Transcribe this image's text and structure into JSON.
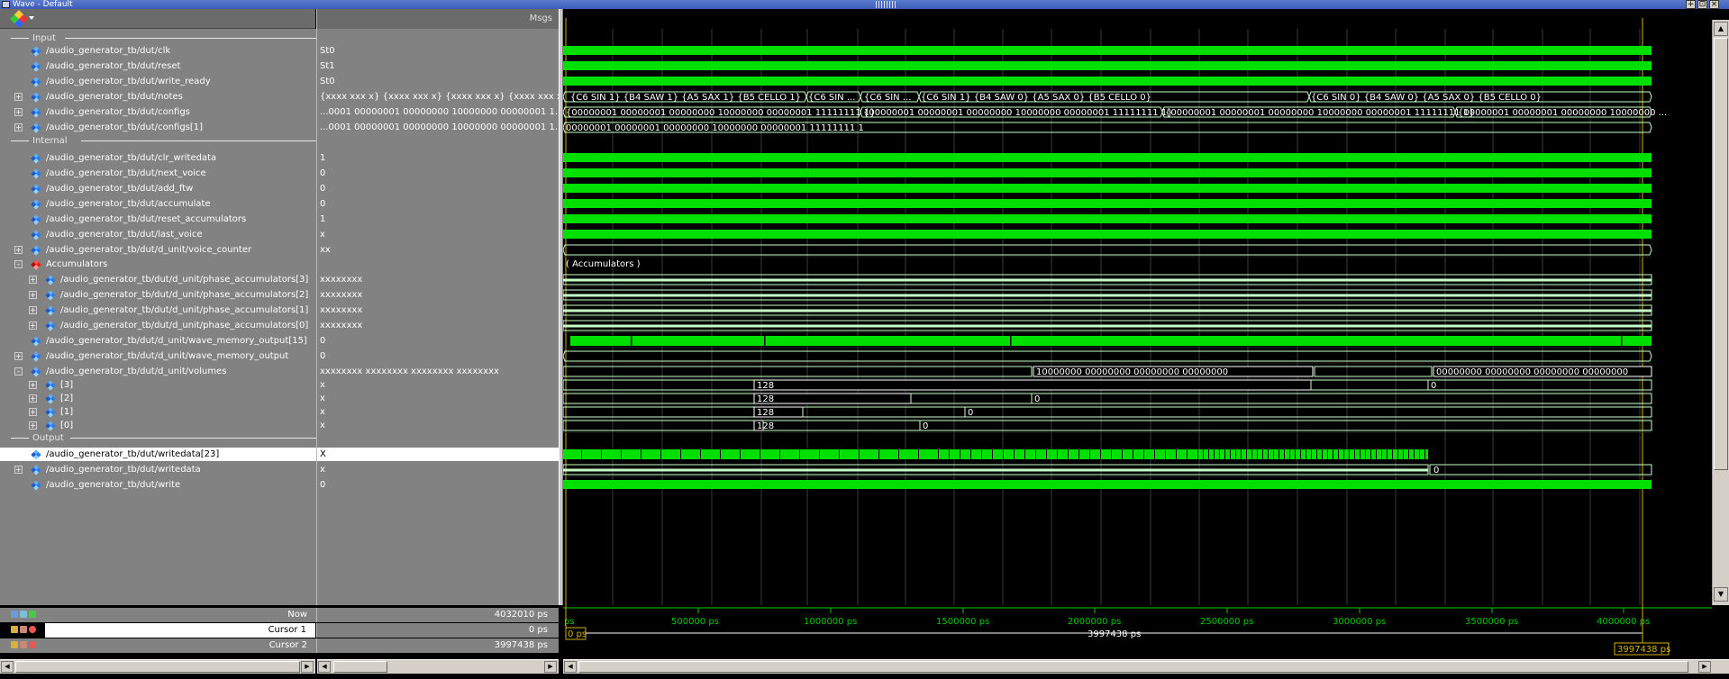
{
  "window": {
    "title": "Wave - Default",
    "buttons": [
      "+",
      "⊡",
      "×"
    ]
  },
  "header": {
    "msgs_label": "Msgs"
  },
  "rows": [
    {
      "kind": "group",
      "label": "Input"
    },
    {
      "kind": "signal",
      "name": "/audio_generator_tb/dut/clk",
      "value": "St0",
      "indent": 0,
      "expand": "",
      "icon": "blue"
    },
    {
      "kind": "signal",
      "name": "/audio_generator_tb/dut/reset",
      "value": "St1",
      "indent": 0,
      "expand": "",
      "icon": "blue"
    },
    {
      "kind": "signal",
      "name": "/audio_generator_tb/dut/write_ready",
      "value": "St0",
      "indent": 0,
      "expand": "",
      "icon": "blue"
    },
    {
      "kind": "signal",
      "name": "/audio_generator_tb/dut/notes",
      "value": "{xxxx xxx x} {xxxx xxx x} {xxxx xxx x} {xxxx xxx x}",
      "indent": 0,
      "expand": "+",
      "icon": "blue"
    },
    {
      "kind": "signal",
      "name": "/audio_generator_tb/dut/configs",
      "value": "...0001 00000001 00000000 10000000 00000001 1...",
      "indent": 0,
      "expand": "+",
      "icon": "blue"
    },
    {
      "kind": "signal",
      "name": "/audio_generator_tb/dut/configs[1]",
      "value": "...0001 00000001 00000000 10000000 00000001 1...",
      "indent": 0,
      "expand": "+",
      "icon": "blue"
    },
    {
      "kind": "group",
      "label": "Internal"
    },
    {
      "kind": "signal",
      "name": "/audio_generator_tb/dut/clr_writedata",
      "value": "1",
      "indent": 0,
      "expand": "",
      "icon": "blue"
    },
    {
      "kind": "signal",
      "name": "/audio_generator_tb/dut/next_voice",
      "value": "0",
      "indent": 0,
      "expand": "",
      "icon": "blue"
    },
    {
      "kind": "signal",
      "name": "/audio_generator_tb/dut/add_ftw",
      "value": "0",
      "indent": 0,
      "expand": "",
      "icon": "blue"
    },
    {
      "kind": "signal",
      "name": "/audio_generator_tb/dut/accumulate",
      "value": "0",
      "indent": 0,
      "expand": "",
      "icon": "blue"
    },
    {
      "kind": "signal",
      "name": "/audio_generator_tb/dut/reset_accumulators",
      "value": "1",
      "indent": 0,
      "expand": "",
      "icon": "blue"
    },
    {
      "kind": "signal",
      "name": "/audio_generator_tb/dut/last_voice",
      "value": "x",
      "indent": 0,
      "expand": "",
      "icon": "blue"
    },
    {
      "kind": "signal",
      "name": "/audio_generator_tb/dut/d_unit/voice_counter",
      "value": "xx",
      "indent": 0,
      "expand": "+",
      "icon": "blue"
    },
    {
      "kind": "signal",
      "name": "Accumulators",
      "value": "",
      "indent": 0,
      "expand": "-",
      "icon": "red"
    },
    {
      "kind": "signal",
      "name": "/audio_generator_tb/dut/d_unit/phase_accumulators[3]",
      "value": "xxxxxxxx",
      "indent": 1,
      "expand": "+",
      "icon": "blue"
    },
    {
      "kind": "signal",
      "name": "/audio_generator_tb/dut/d_unit/phase_accumulators[2]",
      "value": "xxxxxxxx",
      "indent": 1,
      "expand": "+",
      "icon": "blue"
    },
    {
      "kind": "signal",
      "name": "/audio_generator_tb/dut/d_unit/phase_accumulators[1]",
      "value": "xxxxxxxx",
      "indent": 1,
      "expand": "+",
      "icon": "blue"
    },
    {
      "kind": "signal",
      "name": "/audio_generator_tb/dut/d_unit/phase_accumulators[0]",
      "value": "xxxxxxxx",
      "indent": 1,
      "expand": "+",
      "icon": "blue"
    },
    {
      "kind": "signal",
      "name": "/audio_generator_tb/dut/d_unit/wave_memory_output[15]",
      "value": "0",
      "indent": 0,
      "expand": "",
      "icon": "blue"
    },
    {
      "kind": "signal",
      "name": "/audio_generator_tb/dut/d_unit/wave_memory_output",
      "value": "0",
      "indent": 0,
      "expand": "+",
      "icon": "blue"
    },
    {
      "kind": "signal",
      "name": "/audio_generator_tb/dut/d_unit/volumes",
      "value": "xxxxxxxx xxxxxxxx xxxxxxxx xxxxxxxx",
      "indent": 0,
      "expand": "-",
      "icon": "blue"
    },
    {
      "kind": "signal",
      "name": "[3]",
      "value": "x",
      "indent": 1,
      "expand": "+",
      "icon": "blue"
    },
    {
      "kind": "signal",
      "name": "[2]",
      "value": "x",
      "indent": 1,
      "expand": "+",
      "icon": "blue"
    },
    {
      "kind": "signal",
      "name": "[1]",
      "value": "x",
      "indent": 1,
      "expand": "+",
      "icon": "blue"
    },
    {
      "kind": "signal",
      "name": "[0]",
      "value": "x",
      "indent": 1,
      "expand": "+",
      "icon": "blue"
    },
    {
      "kind": "group",
      "label": "Output"
    },
    {
      "kind": "signal",
      "name": "/audio_generator_tb/dut/writedata[23]",
      "value": "X",
      "indent": 0,
      "expand": "",
      "icon": "blue",
      "selected": true
    },
    {
      "kind": "signal",
      "name": "/audio_generator_tb/dut/writedata",
      "value": "x",
      "indent": 0,
      "expand": "+",
      "icon": "blue"
    },
    {
      "kind": "signal",
      "name": "/audio_generator_tb/dut/write",
      "value": "0",
      "indent": 0,
      "expand": "",
      "icon": "blue"
    }
  ],
  "waves": {
    "notes_labels": [
      "{C6 SIN 1} {B4 SAW 1} {A5 SAX 1} {B5 CELLO 1}",
      "{C6 SIN ...",
      "{C6 SIN ...",
      "{C6 SIN 1} {B4 SAW 0} {A5 SAX 0} {B5 CELLO 0}",
      "{C6 SIN 0} {B4 SAW 0} {A5 SAX 0} {B5 CELLO 0}"
    ],
    "configs_labels": [
      "{00000001 00000001 00000000 10000000 00000001 11111111 1}",
      "{00000001 00000001 00000000 10000000 00000001 11111111 1}",
      "{00000001 00000001 00000000 10000000 00000001 11111111 1}",
      "{00000001 00000001 00000000 10000000 ..."
    ],
    "configs1_label": "00000001 00000001 00000000 10000000 00000001 11111111 1",
    "accumulators_label": "( Accumulators )",
    "volumes_labels": [
      "10000000 00000000 00000000 00000000",
      "00000000 00000000 00000000 00000000"
    ],
    "vol3_labels": [
      "128",
      "0"
    ],
    "vol2_labels": [
      "128",
      "0"
    ],
    "vol1_labels": [
      "128",
      "0"
    ],
    "vol0_labels": [
      "128",
      "0"
    ],
    "writedata_label": "0"
  },
  "footer": {
    "now_label": "Now",
    "now_value": "4032010 ps",
    "cursor1_label": "Cursor 1",
    "cursor1_value": "0 ps",
    "cursor2_label": "Cursor 2",
    "cursor2_value": "3997438 ps",
    "cursor_delta": "3997438 ps",
    "axis_ticks": [
      "ps",
      "500000 ps",
      "1000000 ps",
      "1500000 ps",
      "2000000 ps",
      "2500000 ps",
      "3000000 ps",
      "3500000 ps",
      "4000000 ps"
    ],
    "cursor1_marker": "0 ps",
    "cursor2_marker": "3997438 ps"
  },
  "colors": {
    "wave_green": "#00e000",
    "bus_green": "#c8ffc8",
    "cursor_yellow": "#d4b000",
    "axis_green": "#00c800"
  }
}
